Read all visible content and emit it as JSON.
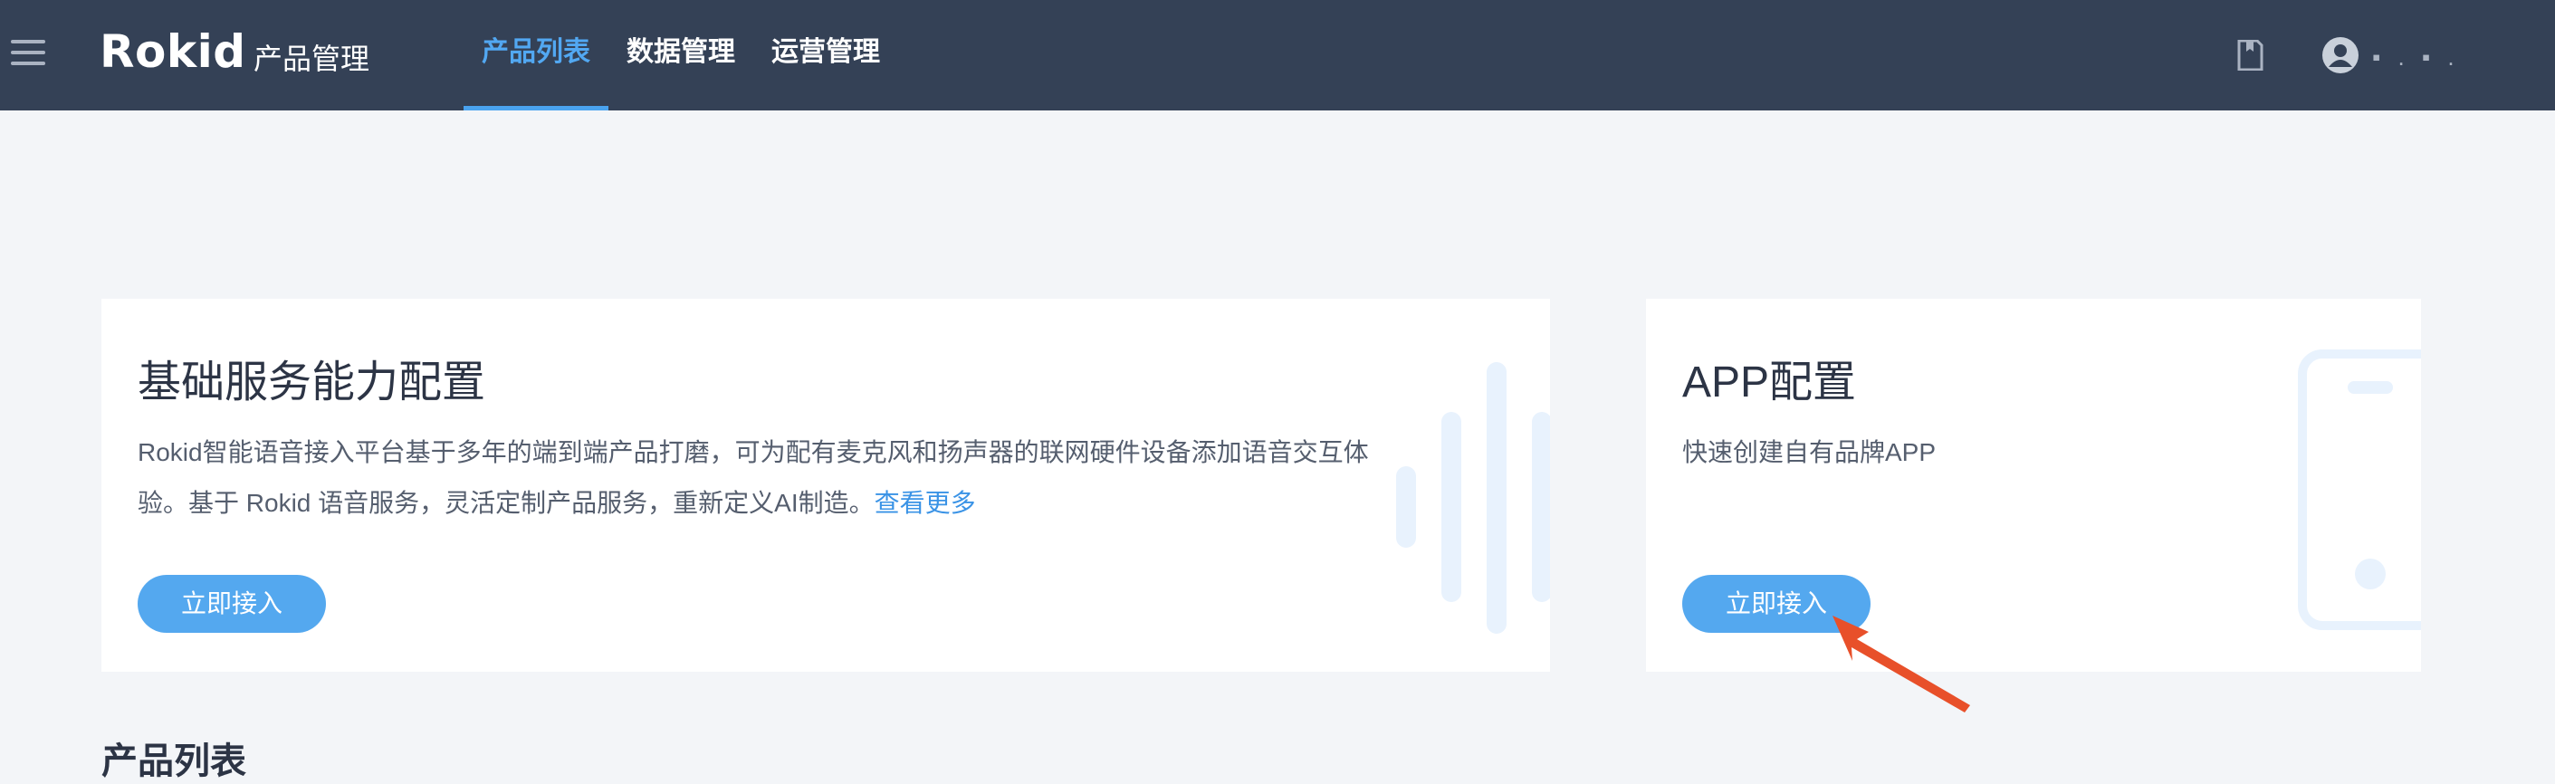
{
  "header": {
    "logo": "Rokid",
    "app_name": "产品管理",
    "nav": [
      {
        "label": "产品列表",
        "active": true
      },
      {
        "label": "数据管理",
        "active": false
      },
      {
        "label": "运营管理",
        "active": false
      }
    ],
    "icons": {
      "menu": "hamburger-icon",
      "docs": "document-icon",
      "user": "user-avatar-icon"
    },
    "user_name": "▪ . ▪ ."
  },
  "cards": [
    {
      "title": "基础服务能力配置",
      "description": "Rokid智能语音接入平台基于多年的端到端产品打磨，可为配有麦克风和扬声器的联网硬件设备添加语音交互体验。基于 Rokid 语音服务，灵活定制产品服务，重新定义AI制造。",
      "link": "查看更多",
      "button": "立即接入",
      "decoration": "sound-wave-icon"
    },
    {
      "title": "APP配置",
      "description": "快速创建自有品牌APP",
      "button": "立即接入",
      "decoration": "phone-icon"
    }
  ],
  "section_heading": "产品列表",
  "colors": {
    "header_bg": "#344156",
    "page_bg": "#f3f5f8",
    "accent": "#54a8ef",
    "nav_active": "#52a8f2",
    "annotation": "#e8502a"
  }
}
